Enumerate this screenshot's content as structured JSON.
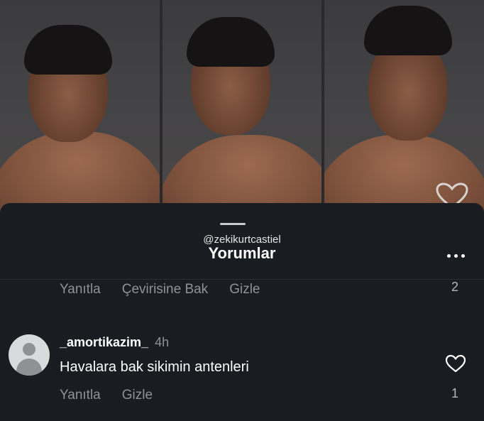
{
  "sheet": {
    "watermark": "@zekikurtcastiel",
    "title": "Yorumlar"
  },
  "top_comment_actions": {
    "reply": "Yanıtla",
    "translate": "Çevirisine Bak",
    "hide": "Gizle",
    "like_count": "2"
  },
  "comment": {
    "username": "_amortikazim_",
    "time": "4h",
    "text": "Havalara bak sikimin antenleri",
    "actions": {
      "reply": "Yanıtla",
      "hide": "Gizle"
    },
    "like_count": "1"
  },
  "icons": {
    "more": "more-horizontal-icon",
    "like": "heart-outline-icon",
    "avatar": "default-avatar-icon"
  },
  "colors": {
    "sheet_background": "#191c21",
    "muted_text": "#8e9299"
  }
}
